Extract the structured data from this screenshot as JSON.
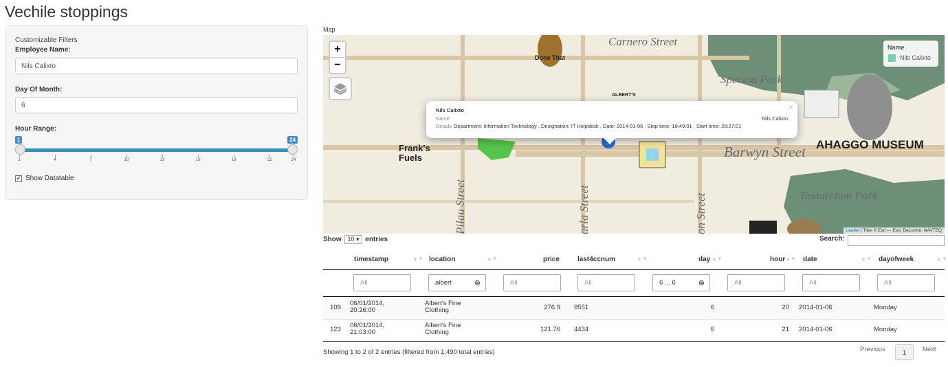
{
  "app": {
    "title": "Vechile stoppings"
  },
  "sidebar": {
    "caption": "Customizable Filters",
    "employee_label": "Employee Name:",
    "employee_value": "Nils Calixto",
    "day_label": "Day Of Month:",
    "day_value": "6",
    "hour_label": "Hour Range:",
    "hour_min": "1",
    "hour_max": "24",
    "hour_ticks": [
      "1",
      "4",
      "7",
      "10",
      "13",
      "16",
      "19",
      "22",
      "24"
    ],
    "show_datatable_label": "Show Datatable",
    "show_datatable_checked": true
  },
  "map": {
    "label": "Map",
    "zoom_in": "+",
    "zoom_out": "−",
    "legend_title": "Name",
    "legend_value": "Nils Calixto",
    "legend_color": "#86c9b3",
    "popup": {
      "title": "Nils Calixto",
      "row1_key": "Name",
      "row1_value": "Nils Calixto",
      "row2_key": "Details",
      "row2_value": "Department: Information Technology , Designation: IT Helpdesk , Date: 2014-01-06 , Stop time: 19:49:01 , Start time: 20:27:01",
      "close": "×"
    },
    "attribution_link": "Leaflet",
    "attribution_text": " | Tiles © Esri — Esri, DeLorme, NAVTEQ",
    "streets": [
      "Carnero Street",
      "Spetson Park",
      "Barwyn Street",
      "AHAGGO MUSEUM",
      "Taxiarchon Park",
      "Pilau Street",
      "arla Street",
      "on Street"
    ],
    "labels": [
      "Done That",
      "Frank's Fuels",
      "ALBERT'S"
    ]
  },
  "table": {
    "show_label": "Show",
    "page_length": "10",
    "entries_label": "entries",
    "search_label": "Search:",
    "search_value": "",
    "columns": [
      "timestamp",
      "location",
      "price",
      "last4ccnum",
      "day",
      "hour",
      "date",
      "dayofweek"
    ],
    "filters": [
      "All",
      "albert",
      "All",
      "All",
      "6 ... 6",
      "All",
      "All",
      "All"
    ],
    "rows": [
      {
        "idx": "109",
        "timestamp": "06/01/2014, 20:26:00",
        "location": "Albert's Fine Clothing",
        "price": "276.9",
        "last4ccnum": "9551",
        "day": "6",
        "hour": "20",
        "date": "2014-01-06",
        "dayofweek": "Monday"
      },
      {
        "idx": "123",
        "timestamp": "06/01/2014, 21:03:00",
        "location": "Albert's Fine Clothing",
        "price": "121.76",
        "last4ccnum": "4434",
        "day": "6",
        "hour": "21",
        "date": "2014-01-06",
        "dayofweek": "Monday"
      }
    ],
    "info": "Showing 1 to 2 of 2 entries (filtered from 1,490 total entries)",
    "previous": "Previous",
    "page": "1",
    "next": "Next"
  }
}
